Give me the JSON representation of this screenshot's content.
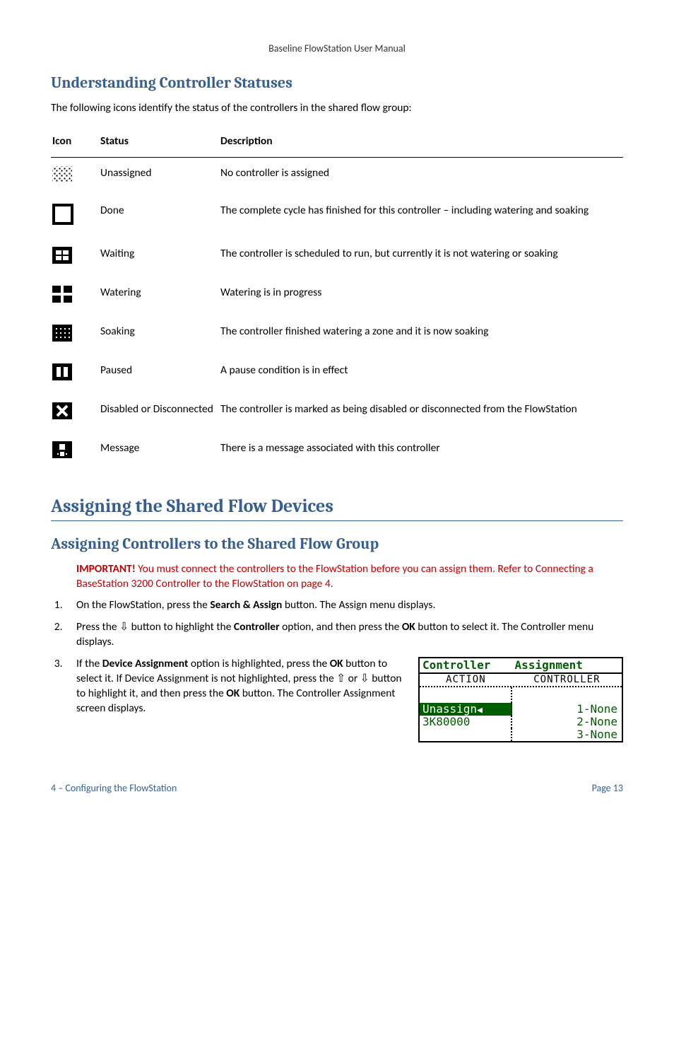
{
  "runningHeader": "Baseline FlowStation User Manual",
  "section1": {
    "heading": "Understanding Controller Statuses",
    "intro": "The following icons identify the status of the controllers in the shared flow group:"
  },
  "statusTable": {
    "head": {
      "icon": "Icon",
      "status": "Status",
      "desc": "Description"
    },
    "rows": [
      {
        "status": "Unassigned",
        "desc": "No controller is assigned",
        "iconClass": "ic-unassigned"
      },
      {
        "status": "Done",
        "desc": "The complete cycle has finished for this controller – including watering and soaking",
        "iconClass": "ic-done"
      },
      {
        "status": "Waiting",
        "desc": "The controller is scheduled to run, but currently it is not watering or soaking",
        "iconClass": "ic-waiting"
      },
      {
        "status": "Watering",
        "desc": "Watering is in progress",
        "iconClass": "ic-watering"
      },
      {
        "status": "Soaking",
        "desc": "The controller finished watering a zone and it is now soaking",
        "iconClass": "ic-soaking"
      },
      {
        "status": "Paused",
        "desc": "A pause condition is in effect",
        "iconClass": "ic-paused"
      },
      {
        "status": "Disabled or Disconnected",
        "desc": "The controller is marked as being disabled or disconnected from the FlowStation",
        "iconClass": "ic-disabled"
      },
      {
        "status": "Message",
        "desc": "There is a message associated with this controller",
        "iconClass": "ic-message"
      }
    ]
  },
  "section2": {
    "heading": "Assigning the Shared Flow Devices"
  },
  "section3": {
    "heading": "Assigning Controllers to the Shared Flow Group",
    "importantLabel": "IMPORTANT!",
    "importantText": " You must connect the controllers to the FlowStation before you can assign them. Refer to Connecting a BaseStation 3200 Controller to the FlowStation on page 4."
  },
  "steps": {
    "s1a": "On the FlowStation, press the ",
    "s1b": "Search & Assign",
    "s1c": " button. The Assign menu displays.",
    "s2a": "Press the ",
    "s2b": " button to highlight the ",
    "s2c": "Controller",
    "s2d": " option, and then press the ",
    "s2e": "OK",
    "s2f": " button to select it. The Controller menu displays.",
    "s3a": "If the ",
    "s3b": "Device Assignment",
    "s3c": " option is highlighted, press the ",
    "s3d": "OK",
    "s3e": " button to select it. If Device Assignment is not highlighted, press the ",
    "s3f": " or ",
    "s3g": " button to highlight it, and then press the ",
    "s3h": "OK",
    "s3i": " button. The Controller Assignment screen displays."
  },
  "lcd": {
    "titleL": "Controller",
    "titleR": "Assignment",
    "hdrL": "ACTION",
    "hdrR": "CONTROLLER",
    "row1L": "Unassign",
    "row1R": "1-None",
    "row2L": "3K80000",
    "row2R": "2-None",
    "row3R": "3-None"
  },
  "footer": {
    "left": "4 – Configuring the FlowStation",
    "right": "Page 13"
  }
}
